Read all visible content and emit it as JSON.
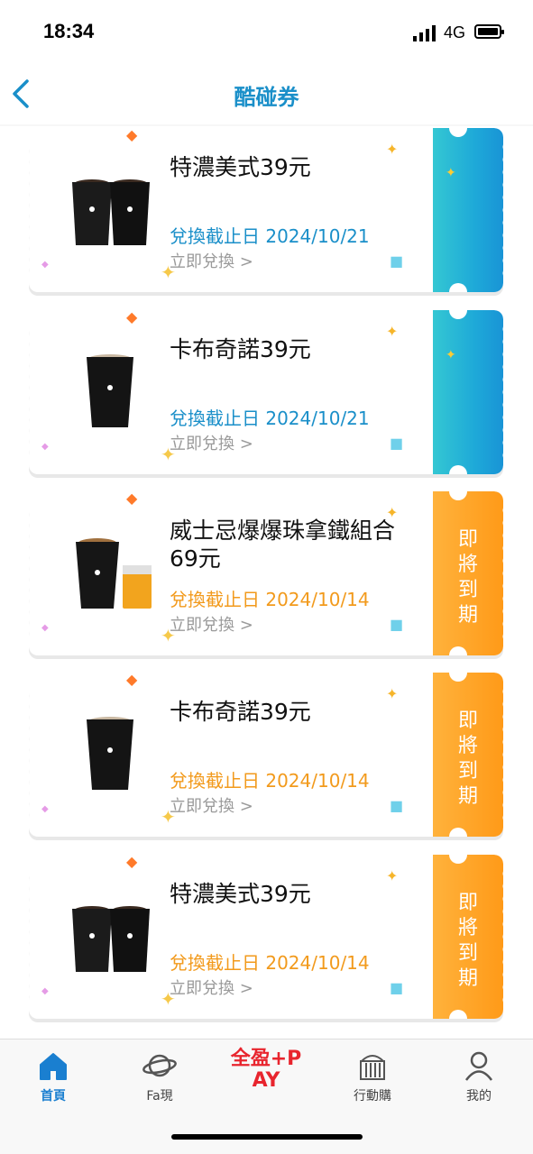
{
  "status": {
    "time": "18:34",
    "network": "4G"
  },
  "nav": {
    "title": "酷碰券"
  },
  "coupons": [
    {
      "title": "特濃美式39元",
      "date": "兌換截止日 2024/10/21",
      "redeem": "立即兌換 >",
      "badge": ""
    },
    {
      "title": "卡布奇諾39元",
      "date": "兌換截止日 2024/10/21",
      "redeem": "立即兌換 >",
      "badge": ""
    },
    {
      "title": "威士忌爆爆珠拿鐵組合69元",
      "date": "兌換截止日 2024/10/14",
      "redeem": "立即兌換 >",
      "badge": "即將到期"
    },
    {
      "title": "卡布奇諾39元",
      "date": "兌換截止日 2024/10/14",
      "redeem": "立即兌換 >",
      "badge": "即將到期"
    },
    {
      "title": "特濃美式39元",
      "date": "兌換截止日 2024/10/14",
      "redeem": "立即兌換 >",
      "badge": "即將到期"
    }
  ],
  "colors": {
    "accent_blue": "#1a8fc9",
    "expiring_orange": "#ff9a18"
  },
  "tabbar": {
    "items": [
      {
        "label": "首頁",
        "icon": "home-icon"
      },
      {
        "label": "Fa現",
        "icon": "planet-icon"
      },
      {
        "label": "全盈+PAY",
        "icon": "pay-logo"
      },
      {
        "label": "行動購",
        "icon": "shop-icon"
      },
      {
        "label": "我的",
        "icon": "person-icon"
      }
    ]
  }
}
